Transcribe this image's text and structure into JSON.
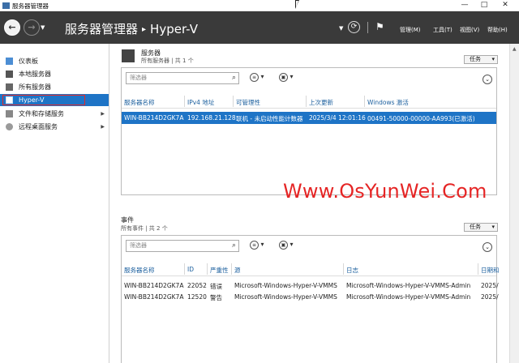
{
  "window": {
    "title": "服务器管理器",
    "min": "—",
    "max": "□",
    "close": "✕"
  },
  "header": {
    "breadcrumb_root": "服务器管理器",
    "breadcrumb_sep": "▸",
    "breadcrumb_current": "Hyper-V",
    "menus": [
      "管理(M)",
      "工具(T)",
      "视图(V)",
      "帮助(H)"
    ]
  },
  "sidebar": {
    "items": [
      {
        "label": "仪表板",
        "icon": "dashboard-icon"
      },
      {
        "label": "本地服务器",
        "icon": "server-icon"
      },
      {
        "label": "所有服务器",
        "icon": "servers-icon"
      },
      {
        "label": "Hyper-V",
        "icon": "hyper-v-icon",
        "active": true
      },
      {
        "label": "文件和存储服务",
        "icon": "storage-icon",
        "has_children": true
      },
      {
        "label": "远程桌面服务",
        "icon": "remote-desktop-icon",
        "has_children": true
      }
    ]
  },
  "servers": {
    "title": "服务器",
    "subtitle": "所有服务器 | 共 1 个",
    "tasks_label": "任务",
    "filter_placeholder": "筛选器",
    "columns": [
      "服务器名称",
      "IPv4 地址",
      "可管理性",
      "上次更新",
      "Windows 激活"
    ],
    "rows": [
      {
        "name": "WIN-BB214D2GK7A",
        "ipv4": "192.168.21.128",
        "manageability": "联机 - 未启动性能计数器",
        "last_update": "2025/3/4 12:01:16",
        "activation": "00491-50000-00000-AA993(已激活)",
        "selected": true
      }
    ]
  },
  "events": {
    "title": "事件",
    "subtitle": "所有事件 | 共 2 个",
    "tasks_label": "任务",
    "filter_placeholder": "筛选器",
    "columns": [
      "服务器名称",
      "ID",
      "严重性",
      "源",
      "日志",
      "日期和"
    ],
    "rows": [
      {
        "server": "WIN-BB214D2GK7A",
        "id": "22052",
        "severity": "错误",
        "source": "Microsoft-Windows-Hyper-V-VMMS",
        "log": "Microsoft-Windows-Hyper-V-VMMS-Admin",
        "date": "2025/"
      },
      {
        "server": "WIN-BB214D2GK7A",
        "id": "12520",
        "severity": "警告",
        "source": "Microsoft-Windows-Hyper-V-VMMS",
        "log": "Microsoft-Windows-Hyper-V-VMMS-Admin",
        "date": "2025/"
      }
    ]
  },
  "watermark": "Www.OsYunWei.Com",
  "colors": {
    "header_bg": "#3a3a3a",
    "selection": "#1e74c6",
    "watermark": "#e52525",
    "column_header": "#1b5f9e"
  }
}
